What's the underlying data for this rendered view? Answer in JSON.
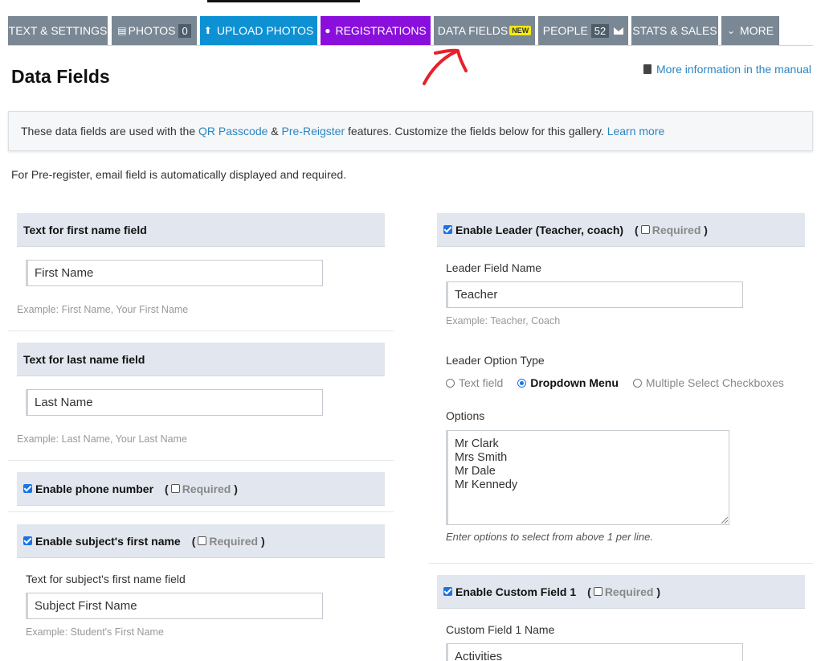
{
  "tabs": [
    {
      "label": "TEXT & SETTINGS"
    },
    {
      "label": "PHOTOS",
      "badge": "0"
    },
    {
      "label": "UPLOAD PHOTOS"
    },
    {
      "label": "REGISTRATIONS"
    },
    {
      "label": "DATA FIELDS",
      "badge": "NEW"
    },
    {
      "label": "PEOPLE",
      "badge": "52"
    },
    {
      "label": "STATS & SALES"
    },
    {
      "label": "MORE"
    }
  ],
  "colors": {
    "tab_grey": "#7a8794",
    "tab_blue": "#0d91d3",
    "tab_purple": "#8a0fdc",
    "link": "#2a86c2",
    "annotation": "#e8202a"
  },
  "page": {
    "title": "Data Fields",
    "manual_link": "More information in the manual"
  },
  "info": {
    "text_before": "These data fields are used with the ",
    "qr_link": "QR Passcode",
    "amp": " & ",
    "prereg_link": "Pre-Reigster",
    "text_after": " features. Customize the fields below for this gallery. ",
    "learn_more": "Learn more"
  },
  "note": "For Pre-register, email field is automatically displayed and required.",
  "left": {
    "first_name": {
      "header": "Text for first name field",
      "value": "First Name",
      "example": "Example: First Name, Your First Name"
    },
    "last_name": {
      "header": "Text for last name field",
      "value": "Last Name",
      "example": "Example: Last Name, Your Last Name"
    },
    "phone": {
      "header": "Enable phone number",
      "required": "Required"
    },
    "subject": {
      "header": "Enable subject's first name",
      "required": "Required",
      "label": "Text for subject's first name field",
      "value": "Subject First Name",
      "example": "Example: Student's First Name"
    }
  },
  "right": {
    "leader": {
      "header": "Enable Leader (Teacher, coach)",
      "required": "Required",
      "name_label": "Leader Field Name",
      "name_value": "Teacher",
      "example": "Example: Teacher, Coach",
      "type_label": "Leader Option Type",
      "types": [
        "Text field",
        "Dropdown Menu",
        "Multiple Select Checkboxes"
      ],
      "selected_type": "Dropdown Menu",
      "options_label": "Options",
      "options": [
        "Mr Clark",
        "Mrs Smith",
        "Mr Dale",
        "Mr Kennedy"
      ],
      "hint": "Enter options to select from above 1 per line."
    },
    "custom1": {
      "header": "Enable Custom Field 1",
      "required": "Required",
      "name_label": "Custom Field 1 Name",
      "name_value": "Activities"
    }
  }
}
